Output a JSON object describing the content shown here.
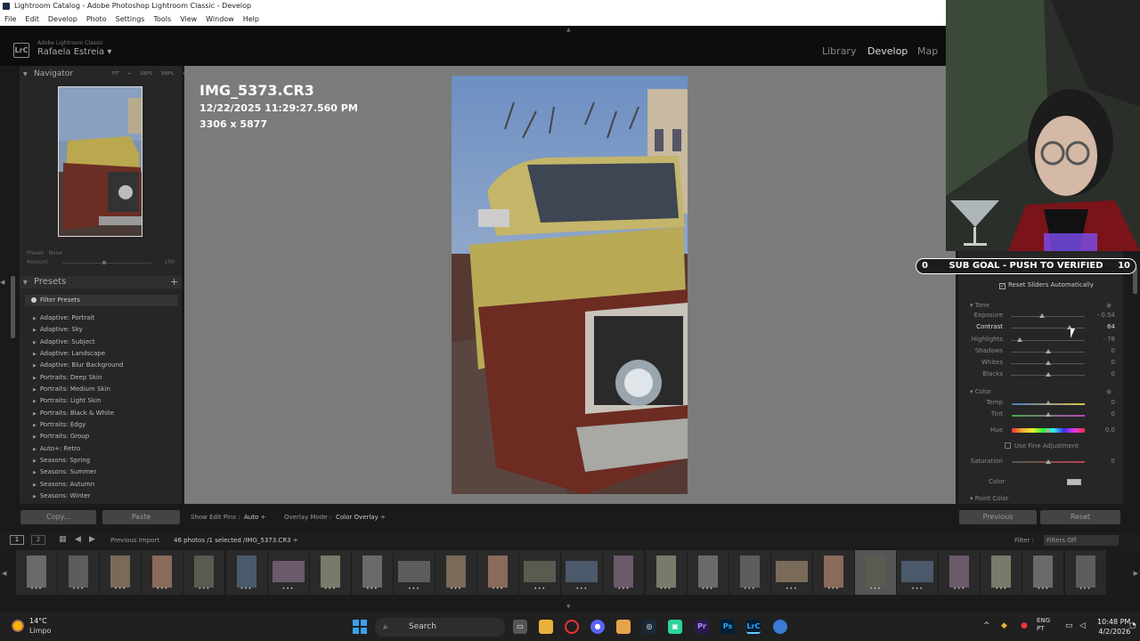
{
  "window": {
    "title": "Lightroom Catalog - Adobe Photoshop Lightroom Classic - Develop"
  },
  "menu": [
    "File",
    "Edit",
    "Develop",
    "Photo",
    "Settings",
    "Tools",
    "View",
    "Window",
    "Help"
  ],
  "identity": {
    "brand": "Adobe Lightroom Classic",
    "user": "Rafaela Estreia",
    "logo": "LrC"
  },
  "modules": {
    "library": "Library",
    "develop": "Develop",
    "map": "Map"
  },
  "navigator": {
    "title": "Navigator",
    "zoom": [
      "FIT ÷",
      "100%",
      "300% ÷"
    ]
  },
  "preset_box": {
    "preset_label": "Preset",
    "preset_value": "None",
    "amount_label": "Amount",
    "amount_value": "100"
  },
  "presets": {
    "title": "Presets",
    "filter": "Filter Presets",
    "items": [
      "Adaptive: Portrait",
      "Adaptive: Sky",
      "Adaptive: Subject",
      "Adaptive: Landscape",
      "Adaptive: Blur Background",
      "Portraits: Deep Skin",
      "Portraits: Medium Skin",
      "Portraits: Light Skin",
      "Portraits: Black & White",
      "Portraits: Edgy",
      "Portraits: Group",
      "Auto+: Retro",
      "Seasons: Spring",
      "Seasons: Summer",
      "Seasons: Autumn",
      "Seasons: Winter"
    ]
  },
  "left_buttons": {
    "copy": "Copy...",
    "paste": "Paste"
  },
  "image_info": {
    "name": "IMG_5373.CR3",
    "datetime": "12/22/2025 11:29:27.560 PM",
    "dimensions": "3306 x 5877"
  },
  "toolbar": {
    "edit_pins_label": "Show Edit Pins :",
    "edit_pins_value": "Auto ÷",
    "overlay_label": "Overlay Mode :",
    "overlay_value": "Color Overlay ÷"
  },
  "overlay": {
    "sub_goal": "SUB GOAL - PUSH TO VERIFIED",
    "left_count": "0",
    "right_count": "10"
  },
  "right_panel": {
    "reset_auto": "Reset Sliders Automatically",
    "tone_title": "Tone",
    "tone": [
      {
        "label": "Exposure",
        "value": "- 0.54",
        "pos": 0.42
      },
      {
        "label": "Contrast",
        "value": "64",
        "pos": 0.79
      },
      {
        "label": "Highlights",
        "value": "- 78",
        "pos": 0.12
      },
      {
        "label": "Shadows",
        "value": "0",
        "pos": 0.5
      },
      {
        "label": "Whites",
        "value": "0",
        "pos": 0.5
      },
      {
        "label": "Blacks",
        "value": "0",
        "pos": 0.5
      }
    ],
    "color_title": "Color",
    "color": [
      {
        "label": "Temp",
        "value": "0",
        "pos": 0.5
      },
      {
        "label": "Tint",
        "value": "0",
        "pos": 0.5
      }
    ],
    "hue": {
      "label": "Hue",
      "value": "0.0",
      "pos": 0.5
    },
    "fine_adjust": "Use Fine Adjustment",
    "saturation": {
      "label": "Saturation",
      "value": "0",
      "pos": 0.5
    },
    "color_label": "Color",
    "point_color": "Point Color",
    "previous": "Previous",
    "reset": "Reset"
  },
  "filmstrip": {
    "source": "Previous Import",
    "count": "46 photos /1 selected /IMG_5373.CR3 ÷",
    "filter_label": "Filter :",
    "filter_value": "Filters Off",
    "selected_index": 20,
    "count_cells": 26
  },
  "taskbar": {
    "temp": "14°C",
    "weather": "Limpo",
    "search": "Search",
    "lang1": "ENG",
    "lang2": "PT",
    "time": "10:48 PM",
    "date": "4/2/2026"
  },
  "colors": {
    "accent": "#fff",
    "panel": "#262626",
    "center": "#7b7b7b"
  }
}
